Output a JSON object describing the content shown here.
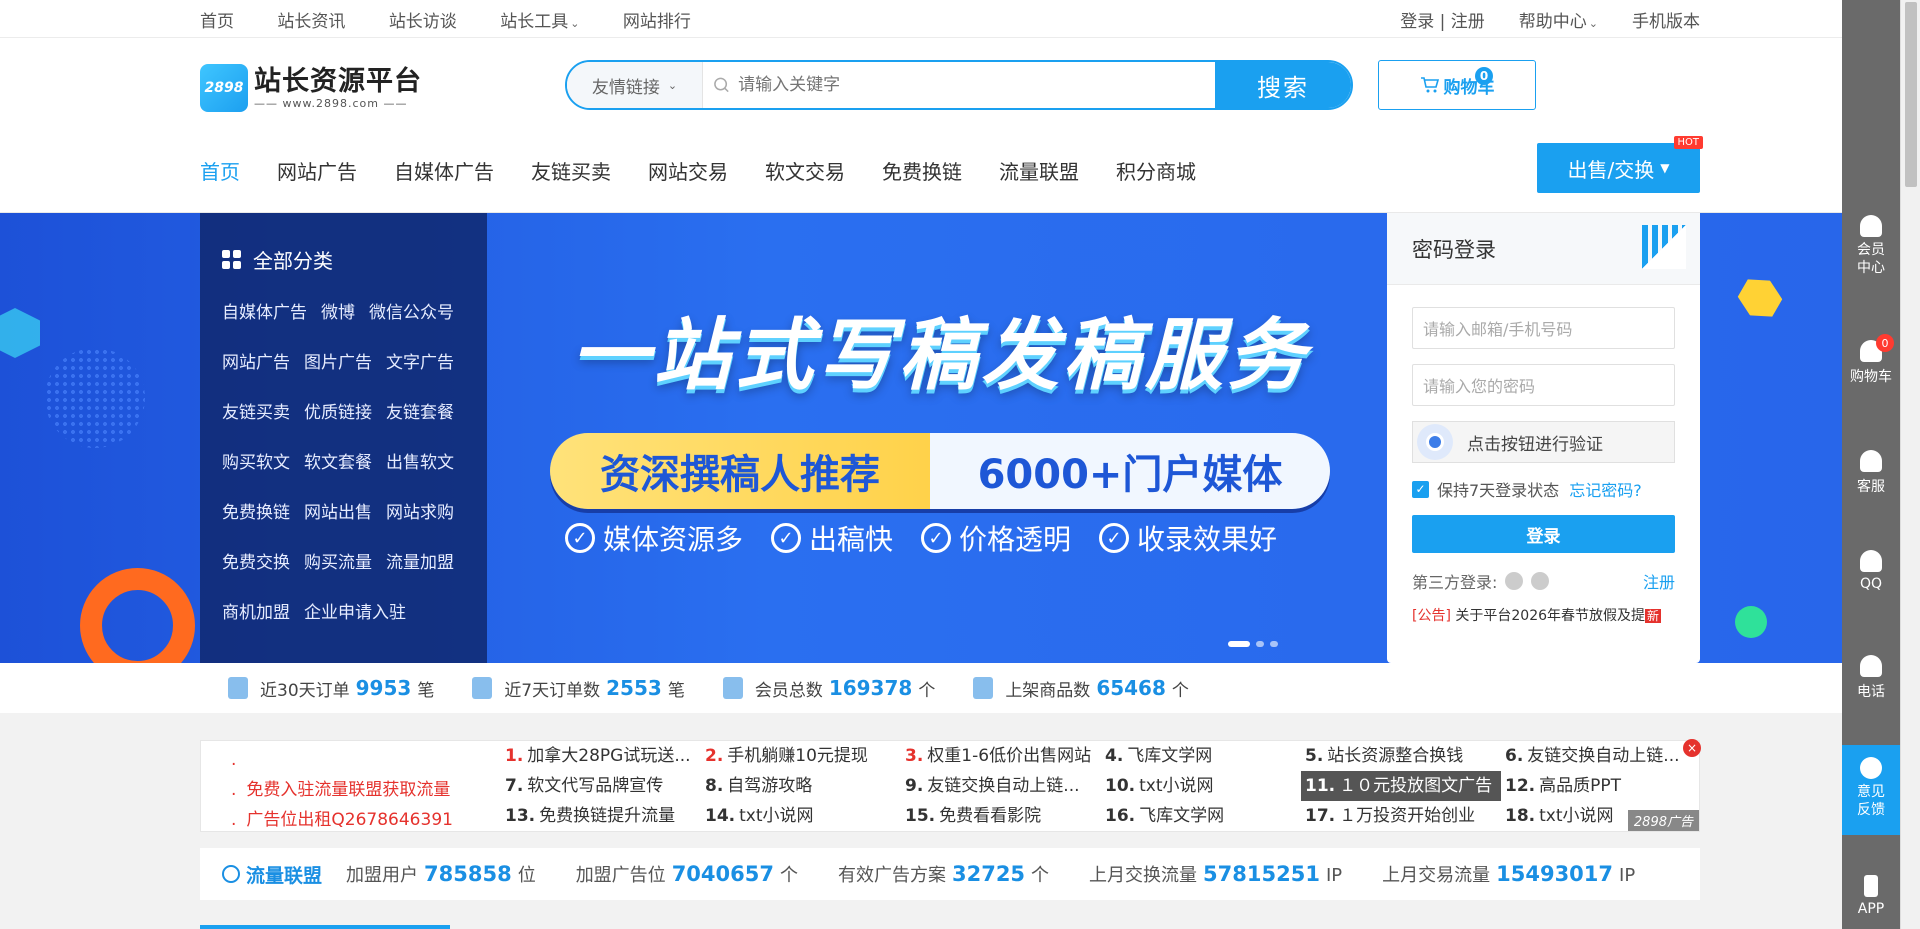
{
  "topbar": {
    "left": [
      "首页",
      "站长资讯",
      "站长访谈",
      "站长工具",
      "网站排行"
    ],
    "tools_has_dropdown": true,
    "right": {
      "login": "登录 | 注册",
      "help": "帮助中心",
      "mobile": "手机版本"
    }
  },
  "logo": {
    "badge": "2898",
    "title": "站长资源平台",
    "url": "—— www.2898.com ——"
  },
  "search": {
    "category": "友情链接",
    "placeholder": "请输入关键字",
    "button": "搜索"
  },
  "cart": {
    "label": "购物车",
    "count": "0"
  },
  "nav": {
    "items": [
      "首页",
      "网站广告",
      "自媒体广告",
      "友链买卖",
      "网站交易",
      "软文交易",
      "免费换链",
      "流量联盟",
      "积分商城"
    ],
    "active_index": 0,
    "sell_button": "出售/交换",
    "hot": "HOT"
  },
  "categories": {
    "title": "全部分类",
    "rows": [
      [
        "自媒体广告",
        "微博",
        "微信公众号"
      ],
      [
        "网站广告",
        "图片广告",
        "文字广告"
      ],
      [
        "友链买卖",
        "优质链接",
        "友链套餐"
      ],
      [
        "购买软文",
        "软文套餐",
        "出售软文"
      ],
      [
        "免费换链",
        "网站出售",
        "网站求购"
      ],
      [
        "免费交换",
        "购买流量",
        "流量加盟"
      ],
      [
        "商机加盟",
        "企业申请入驻"
      ]
    ]
  },
  "banner": {
    "headline": "一站式写稿发稿服务",
    "pill_left": "资深撰稿人推荐",
    "pill_right": "6000+门户媒体",
    "features": [
      "媒体资源多",
      "出稿快",
      "价格透明",
      "收录效果好"
    ],
    "slides": 3,
    "active_slide": 0
  },
  "login": {
    "title": "密码登录",
    "email_placeholder": "请输入邮箱/手机号码",
    "password_placeholder": "请输入您的密码",
    "verify": "点击按钮进行验证",
    "keep": "保持7天登录状态",
    "keep_checked": true,
    "forgot": "忘记密码?",
    "submit": "登录",
    "third_party": "第三方登录:",
    "register": "注册",
    "notice_tag": "[公告]",
    "notice_text": "关于平台2026年春节放假及提",
    "notice_new": "新"
  },
  "stats": [
    {
      "label": "近30天订单",
      "value": "9953",
      "unit": "笔"
    },
    {
      "label": "近7天订单数",
      "value": "2553",
      "unit": "笔"
    },
    {
      "label": "会员总数",
      "value": "169378",
      "unit": "个"
    },
    {
      "label": "上架商品数",
      "value": "65468",
      "unit": "个"
    }
  ],
  "links": {
    "left": [
      ".",
      "免费入驻流量联盟获取流量",
      "广告位出租Q2678646391"
    ],
    "items": [
      {
        "n": "1.",
        "t": "加拿大28PG试玩送..."
      },
      {
        "n": "2.",
        "t": "手机躺赚10元提现"
      },
      {
        "n": "3.",
        "t": "权重1-6低价出售网站"
      },
      {
        "n": "4.",
        "t": "飞库文学网"
      },
      {
        "n": "5.",
        "t": "站长资源整合换钱"
      },
      {
        "n": "6.",
        "t": "友链交换自动上链..."
      },
      {
        "n": "7.",
        "t": "软文代写品牌宣传"
      },
      {
        "n": "8.",
        "t": "自驾游攻略"
      },
      {
        "n": "9.",
        "t": "友链交换自动上链..."
      },
      {
        "n": "10.",
        "t": "txt小说网"
      },
      {
        "n": "11.",
        "t": "１０元投放图文广告"
      },
      {
        "n": "12.",
        "t": "高品质PPT"
      },
      {
        "n": "13.",
        "t": "免费换链提升流量"
      },
      {
        "n": "14.",
        "t": "txt小说网"
      },
      {
        "n": "15.",
        "t": "免费看看影院"
      },
      {
        "n": "16.",
        "t": "飞库文学网"
      },
      {
        "n": "17.",
        "t": "１万投资开始创业"
      },
      {
        "n": "18.",
        "t": "txt小说网"
      }
    ],
    "highlight_index": 10,
    "ad_tag": "2898广告",
    "close": "×"
  },
  "traffic": {
    "title": "流量联盟",
    "items": [
      {
        "label": "加盟用户",
        "value": "785858",
        "unit": "位"
      },
      {
        "label": "加盟广告位",
        "value": "7040657",
        "unit": "个"
      },
      {
        "label": "有效广告方案",
        "value": "32725",
        "unit": "个"
      },
      {
        "label": "上月交换流量",
        "value": "57815251",
        "unit": "IP"
      },
      {
        "label": "上月交易流量",
        "value": "15493017",
        "unit": "IP"
      }
    ]
  },
  "sidebar": {
    "items": [
      "会员\n中心",
      "购物车",
      "客服",
      "QQ",
      "电话",
      "意见\n反馈",
      "APP"
    ],
    "cart_count": "0"
  }
}
